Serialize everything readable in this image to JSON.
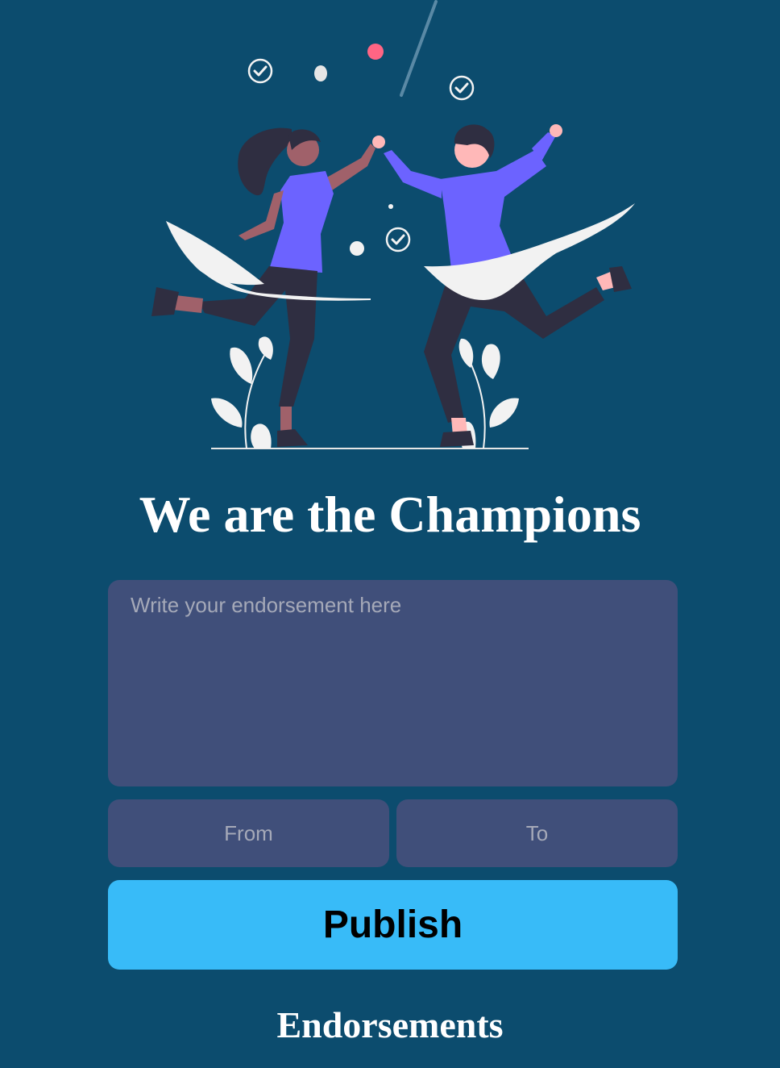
{
  "page": {
    "title": "We are the Champions",
    "endorsement_placeholder": "Write your endorsement here",
    "from_placeholder": "From",
    "to_placeholder": "To",
    "publish_label": "Publish",
    "endorsements_heading": "Endorsements"
  },
  "illustration": {
    "name": "celebrating-couple-illustration",
    "icons": [
      "check-circle-icon",
      "confetti-dot-icon",
      "leaf-plant-icon"
    ]
  },
  "colors": {
    "background": "#0c4c6e",
    "input_bg": "#404f7a",
    "placeholder": "#a5a9b8",
    "button": "#38bbf8",
    "accent_purple": "#6c63ff",
    "accent_pink": "#ff6584"
  }
}
